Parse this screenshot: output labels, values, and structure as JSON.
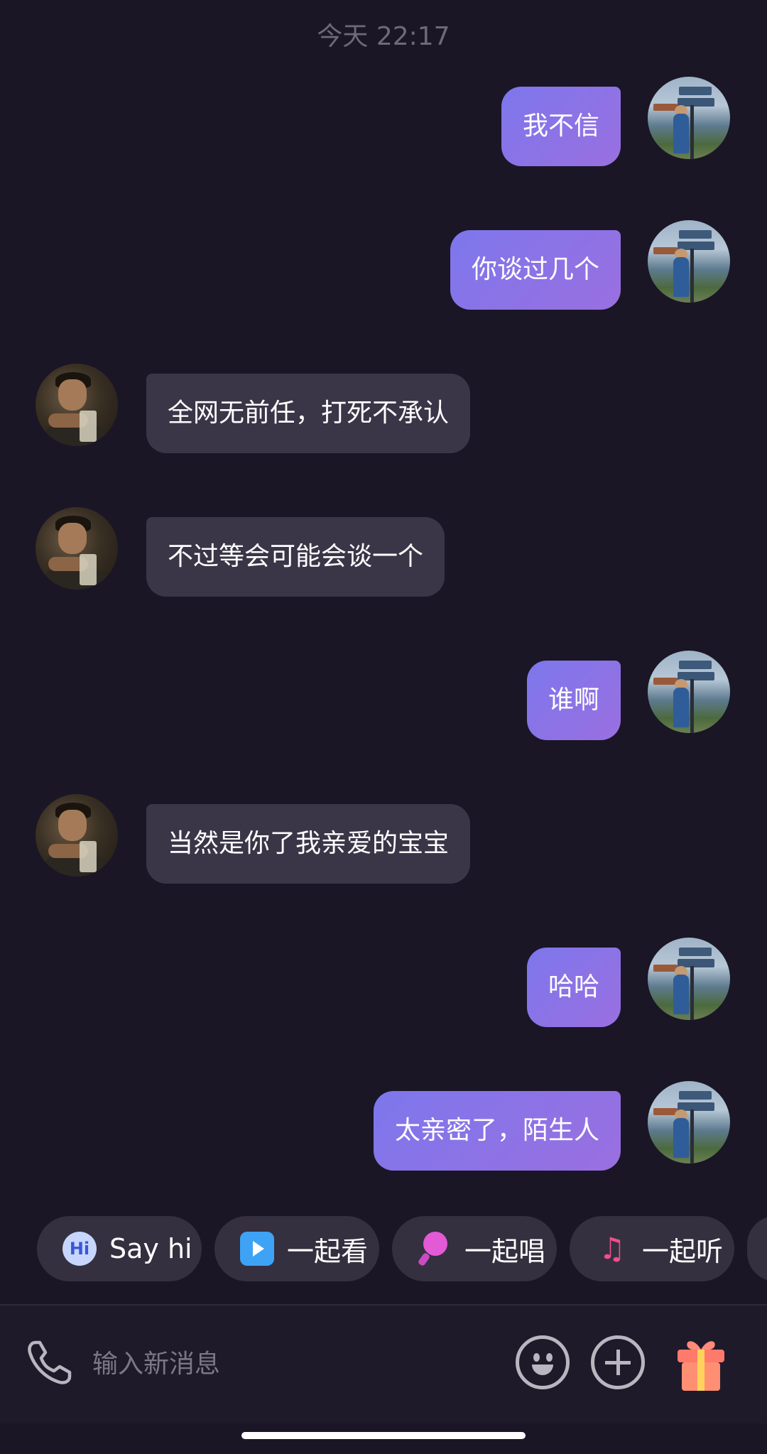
{
  "timestamp": "今天 22:17",
  "messages": [
    {
      "sender": "me",
      "text": "我不信"
    },
    {
      "sender": "me",
      "text": "你谈过几个"
    },
    {
      "sender": "other",
      "text": "全网无前任，打死不承认"
    },
    {
      "sender": "other",
      "text": "不过等会可能会谈一个"
    },
    {
      "sender": "me",
      "text": "谁啊"
    },
    {
      "sender": "other",
      "text": "当然是你了我亲爱的宝宝"
    },
    {
      "sender": "me",
      "text": "哈哈"
    },
    {
      "sender": "me",
      "text": "太亲密了，陌生人"
    }
  ],
  "quick_actions": [
    {
      "label": "Say hi",
      "icon": "hi-bubble-icon",
      "icon_text": "Hi"
    },
    {
      "label": "一起看",
      "icon": "play-icon"
    },
    {
      "label": "一起唱",
      "icon": "microphone-icon"
    },
    {
      "label": "一起听",
      "icon": "music-note-icon",
      "icon_glyph": "♫"
    }
  ],
  "input": {
    "placeholder": "输入新消息"
  },
  "icons": {
    "call": "phone-icon",
    "emoji": "emoji-icon",
    "more": "plus-icon",
    "gift": "gift-icon"
  },
  "colors": {
    "background": "#1a1626",
    "bubble_me_start": "#7d77ec",
    "bubble_me_end": "#9a6fe0",
    "bubble_other": "#3a3647",
    "chip": "#34303f"
  }
}
